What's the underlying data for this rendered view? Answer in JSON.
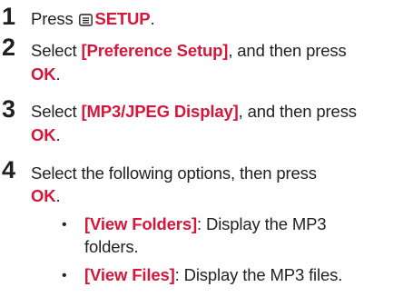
{
  "steps": [
    {
      "number": "1",
      "text_before": "Press ",
      "icon": "menu-icon",
      "keyword": "SETUP",
      "text_after": "."
    },
    {
      "number": "2",
      "text_before": "Select ",
      "keyword": "[Preference Setup]",
      "text_after": ", and then press",
      "keyword2": "OK",
      "text_after2": "."
    },
    {
      "number": "3",
      "text_before": "Select ",
      "keyword": "[MP3/JPEG Display]",
      "text_after": ", and then press",
      "keyword2": "OK",
      "text_after2": "."
    },
    {
      "number": "4",
      "text_before": "Select the following options, then press",
      "keyword2": "OK",
      "text_after2": "."
    }
  ],
  "bullets": [
    {
      "symbol": "•",
      "keyword": "[View Folders]",
      "text": ": Display the MP3",
      "text_cont": "folders."
    },
    {
      "symbol": "•",
      "keyword": "[View Files]",
      "text": ": Display the MP3 files."
    }
  ],
  "colors": {
    "keyword": "#d4173a",
    "text": "#231f20"
  }
}
